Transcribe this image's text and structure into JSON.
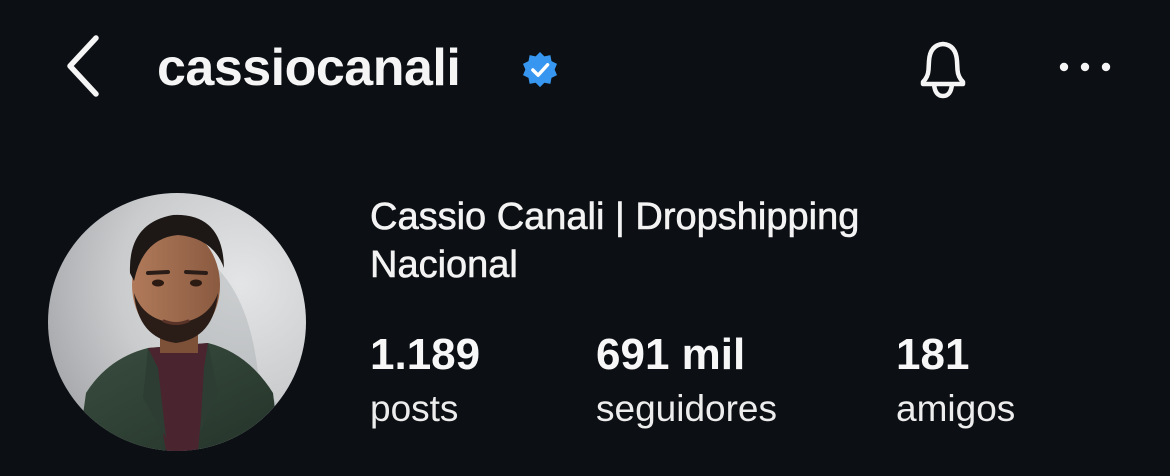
{
  "header": {
    "username": "cassiocanali",
    "icons": {
      "back": "chevron-left-icon",
      "verified": "verified-badge-icon",
      "notifications": "bell-icon",
      "more": "more-horizontal-icon"
    }
  },
  "profile": {
    "display_name": "Cassio Canali | Dropshipping Nacional",
    "avatar": "profile-photo"
  },
  "stats": [
    {
      "value": "1.189",
      "label": "posts"
    },
    {
      "value": "691 mil",
      "label": "seguidores"
    },
    {
      "value": "181",
      "label": "amigos"
    }
  ],
  "colors": {
    "background": "#0c0f14",
    "text": "#f5f5f5",
    "verified_badge": "#3797f0"
  }
}
